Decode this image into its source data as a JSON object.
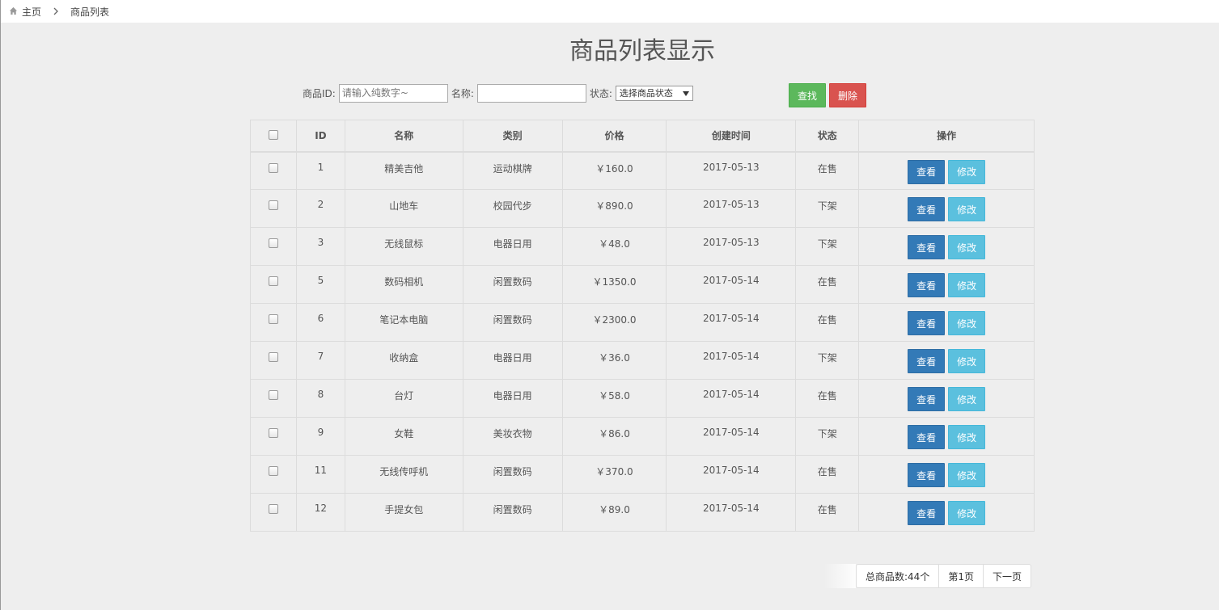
{
  "breadcrumb": {
    "home": "主页",
    "current": "商品列表"
  },
  "title": "商品列表显示",
  "search": {
    "id_label": "商品ID:",
    "id_placeholder": "请输入纯数字~",
    "name_label": "名称:",
    "name_value": "",
    "status_label": "状态:",
    "status_selected": "选择商品状态",
    "search_button": "查找",
    "delete_button": "删除"
  },
  "table": {
    "headers": [
      "",
      "ID",
      "名称",
      "类别",
      "价格",
      "创建时间",
      "状态",
      "操作"
    ],
    "view_label": "查看",
    "edit_label": "修改",
    "rows": [
      {
        "id": "1",
        "name": "精美吉他",
        "category": "运动棋牌",
        "price": "￥160.0",
        "created": "2017-05-13",
        "status": "在售"
      },
      {
        "id": "2",
        "name": "山地车",
        "category": "校园代步",
        "price": "￥890.0",
        "created": "2017-05-13",
        "status": "下架"
      },
      {
        "id": "3",
        "name": "无线鼠标",
        "category": "电器日用",
        "price": "￥48.0",
        "created": "2017-05-13",
        "status": "下架"
      },
      {
        "id": "5",
        "name": "数码相机",
        "category": "闲置数码",
        "price": "￥1350.0",
        "created": "2017-05-14",
        "status": "在售"
      },
      {
        "id": "6",
        "name": "笔记本电脑",
        "category": "闲置数码",
        "price": "￥2300.0",
        "created": "2017-05-14",
        "status": "在售"
      },
      {
        "id": "7",
        "name": "收纳盒",
        "category": "电器日用",
        "price": "￥36.0",
        "created": "2017-05-14",
        "status": "下架"
      },
      {
        "id": "8",
        "name": "台灯",
        "category": "电器日用",
        "price": "￥58.0",
        "created": "2017-05-14",
        "status": "在售"
      },
      {
        "id": "9",
        "name": "女鞋",
        "category": "美妆衣物",
        "price": "￥86.0",
        "created": "2017-05-14",
        "status": "下架"
      },
      {
        "id": "11",
        "name": "无线传呼机",
        "category": "闲置数码",
        "price": "￥370.0",
        "created": "2017-05-14",
        "status": "在售"
      },
      {
        "id": "12",
        "name": "手提女包",
        "category": "闲置数码",
        "price": "￥89.0",
        "created": "2017-05-14",
        "status": "在售"
      }
    ]
  },
  "pagination": {
    "total": "总商品数:44个",
    "current": "第1页",
    "next": "下一页"
  },
  "colors": {
    "on_sale": "#0000cc",
    "off_shelf": "#cc0000",
    "search": "#5cb85c",
    "delete": "#d9534f",
    "view": "#337ab7",
    "edit": "#5bc0de"
  }
}
